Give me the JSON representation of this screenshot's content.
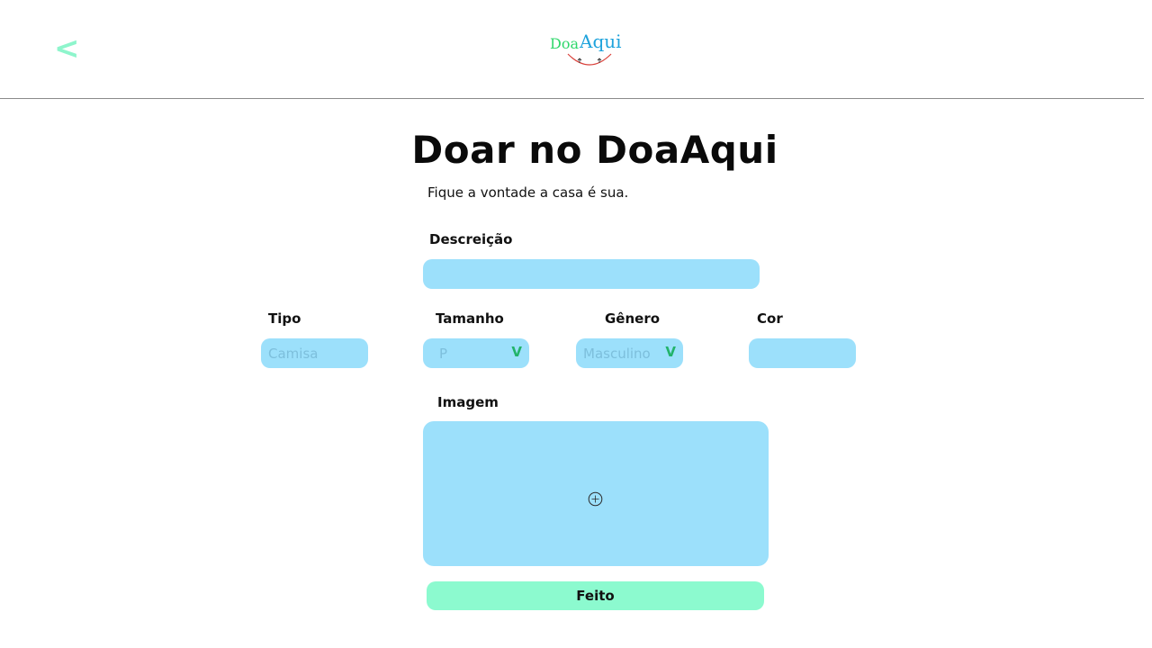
{
  "header": {
    "back_label": "<",
    "logo": {
      "part1": "Doa",
      "part2": "Aqui"
    }
  },
  "main": {
    "title": "Doar no DoaAqui",
    "subtitle": "Fique a vontade a casa é sua."
  },
  "form": {
    "description": {
      "label": "Descreição",
      "value": ""
    },
    "type": {
      "label": "Tipo",
      "placeholder": "Camisa"
    },
    "size": {
      "label": "Tamanho",
      "value": "P",
      "chevron": "V"
    },
    "gender": {
      "label": "Gênero",
      "value": "Masculino",
      "chevron": "V"
    },
    "color": {
      "label": "Cor",
      "value": ""
    },
    "image": {
      "label": "Imagem",
      "icon": "add-circle-icon"
    },
    "submit_label": "Feito"
  },
  "colors": {
    "accent_green": "#8cfacf",
    "field_blue": "#9ce0fb",
    "chevron_green": "#22b36a",
    "logo_green": "#2fd76b",
    "logo_blue": "#1fa3dc"
  }
}
